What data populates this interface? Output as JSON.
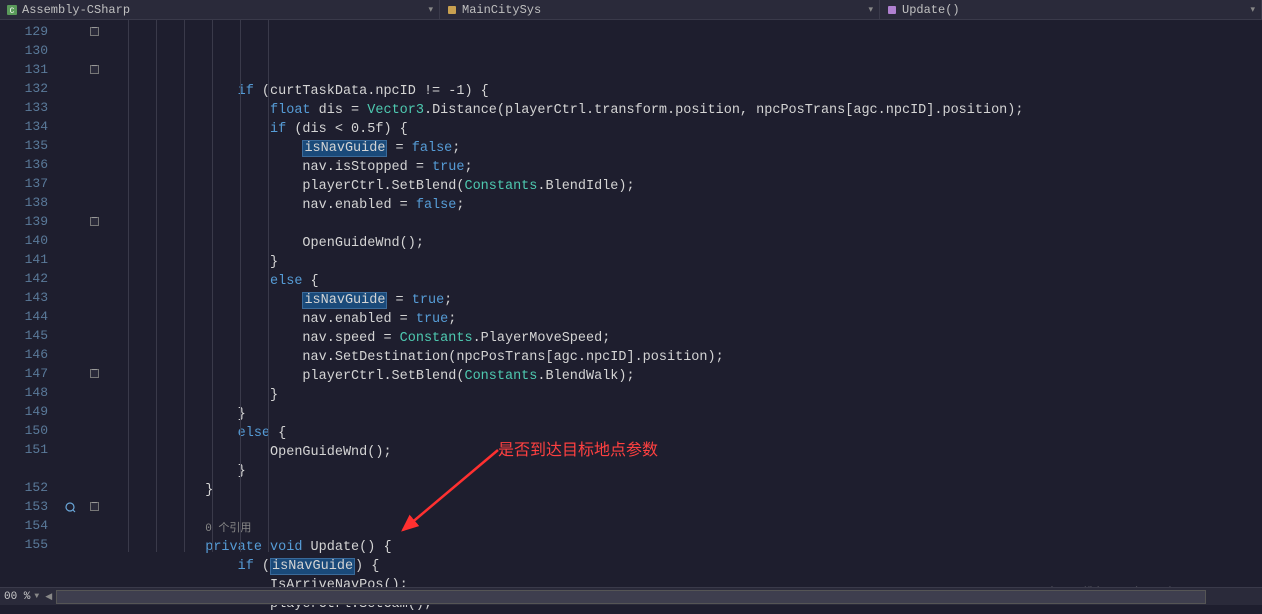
{
  "nav": {
    "assembly": "Assembly-CSharp",
    "class": "MainCitySys",
    "method": "Update()"
  },
  "gutter": {
    "start": 129,
    "end": 155
  },
  "fold_lines": [
    129,
    131,
    139,
    147,
    153
  ],
  "ref_icon_line": 153,
  "code": [
    {
      "i": 0,
      "t": "<span class='kw'>if</span> (curtTaskData.npcID != -1) {",
      "ind": 4
    },
    {
      "i": 1,
      "t": "<span class='kw'>float</span> dis = <span class='type'>Vector3</span>.Distance(playerCtrl.transform.position, npcPosTrans[agc.npcID].position);",
      "ind": 5
    },
    {
      "i": 2,
      "t": "<span class='kw'>if</span> (dis &lt; 0.5f) {",
      "ind": 5
    },
    {
      "i": 3,
      "t": "<span class='hl'>isNavGuide</span> = <span class='lit'>false</span>;",
      "ind": 6
    },
    {
      "i": 4,
      "t": "nav.isStopped = <span class='lit'>true</span>;",
      "ind": 6
    },
    {
      "i": 5,
      "t": "playerCtrl.SetBlend(<span class='type'>Constants</span>.BlendIdle);",
      "ind": 6
    },
    {
      "i": 6,
      "t": "nav.enabled = <span class='lit'>false</span>;",
      "ind": 6
    },
    {
      "i": 7,
      "t": "",
      "ind": 6
    },
    {
      "i": 8,
      "t": "OpenGuideWnd();",
      "ind": 6
    },
    {
      "i": 9,
      "t": "}",
      "ind": 5
    },
    {
      "i": 10,
      "t": "<span class='kw'>else</span> {",
      "ind": 5
    },
    {
      "i": 11,
      "t": "<span class='hl'>isNavGuide</span> = <span class='lit'>true</span>;",
      "ind": 6
    },
    {
      "i": 12,
      "t": "nav.enabled = <span class='lit'>true</span>;",
      "ind": 6
    },
    {
      "i": 13,
      "t": "nav.speed = <span class='type'>Constants</span>.PlayerMoveSpeed;",
      "ind": 6
    },
    {
      "i": 14,
      "t": "nav.SetDestination(npcPosTrans[agc.npcID].position);",
      "ind": 6
    },
    {
      "i": 15,
      "t": "playerCtrl.SetBlend(<span class='type'>Constants</span>.BlendWalk);",
      "ind": 6
    },
    {
      "i": 16,
      "t": "}",
      "ind": 5
    },
    {
      "i": 17,
      "t": "}",
      "ind": 4
    },
    {
      "i": 18,
      "t": "<span class='kw'>else</span> {",
      "ind": 4
    },
    {
      "i": 19,
      "t": "OpenGuideWnd();",
      "ind": 5
    },
    {
      "i": 20,
      "t": "}",
      "ind": 4
    },
    {
      "i": 21,
      "t": "}",
      "ind": 3
    },
    {
      "i": 22,
      "t": "",
      "ind": 0
    },
    {
      "i": 23,
      "t": "<span class='ref'>0 个引用</span>",
      "ind": 3,
      "ref": true
    },
    {
      "i": 24,
      "t": "<span class='kw'>private</span> <span class='kw'>void</span> Update() {",
      "ind": 3
    },
    {
      "i": 25,
      "t": "<span class='kw'>if</span> (<span class='hl'>isNavGuide</span>) {",
      "ind": 4
    },
    {
      "i": 26,
      "t": "IsArriveNavPos();",
      "ind": 5
    },
    {
      "i": 27,
      "t": "playerCtrl.SetCam();",
      "ind": 5
    }
  ],
  "annotation": "是否到达目标地点参数",
  "watermark": "https://blog.csdn.net/qq_40629631",
  "zoom": "00 %"
}
